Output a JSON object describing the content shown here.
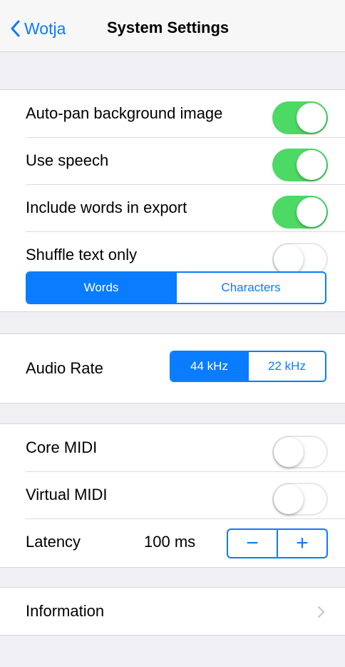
{
  "nav": {
    "back_label": "Wotja",
    "title": "System Settings"
  },
  "display": {
    "rows": [
      {
        "label": "Auto-pan background image",
        "on": true
      },
      {
        "label": "Use speech",
        "on": true
      },
      {
        "label": "Include words in export",
        "on": true
      },
      {
        "label": "Shuffle text only",
        "on": false
      }
    ],
    "shuffle_segments": [
      "Words",
      "Characters"
    ],
    "shuffle_selected": "Words"
  },
  "audio": {
    "label": "Audio Rate",
    "segments": [
      "44 kHz",
      "22 kHz"
    ],
    "selected": "44 kHz"
  },
  "midi": {
    "rows": [
      {
        "label": "Core MIDI",
        "on": false
      },
      {
        "label": "Virtual MIDI",
        "on": false
      }
    ],
    "latency_label": "Latency",
    "latency_value": "100 ms",
    "stepper_minus": "−",
    "stepper_plus": "+"
  },
  "info": {
    "label": "Information"
  },
  "colors": {
    "accent": "#0a7cff",
    "switch_on": "#4cd964",
    "background": "#efeff4"
  }
}
